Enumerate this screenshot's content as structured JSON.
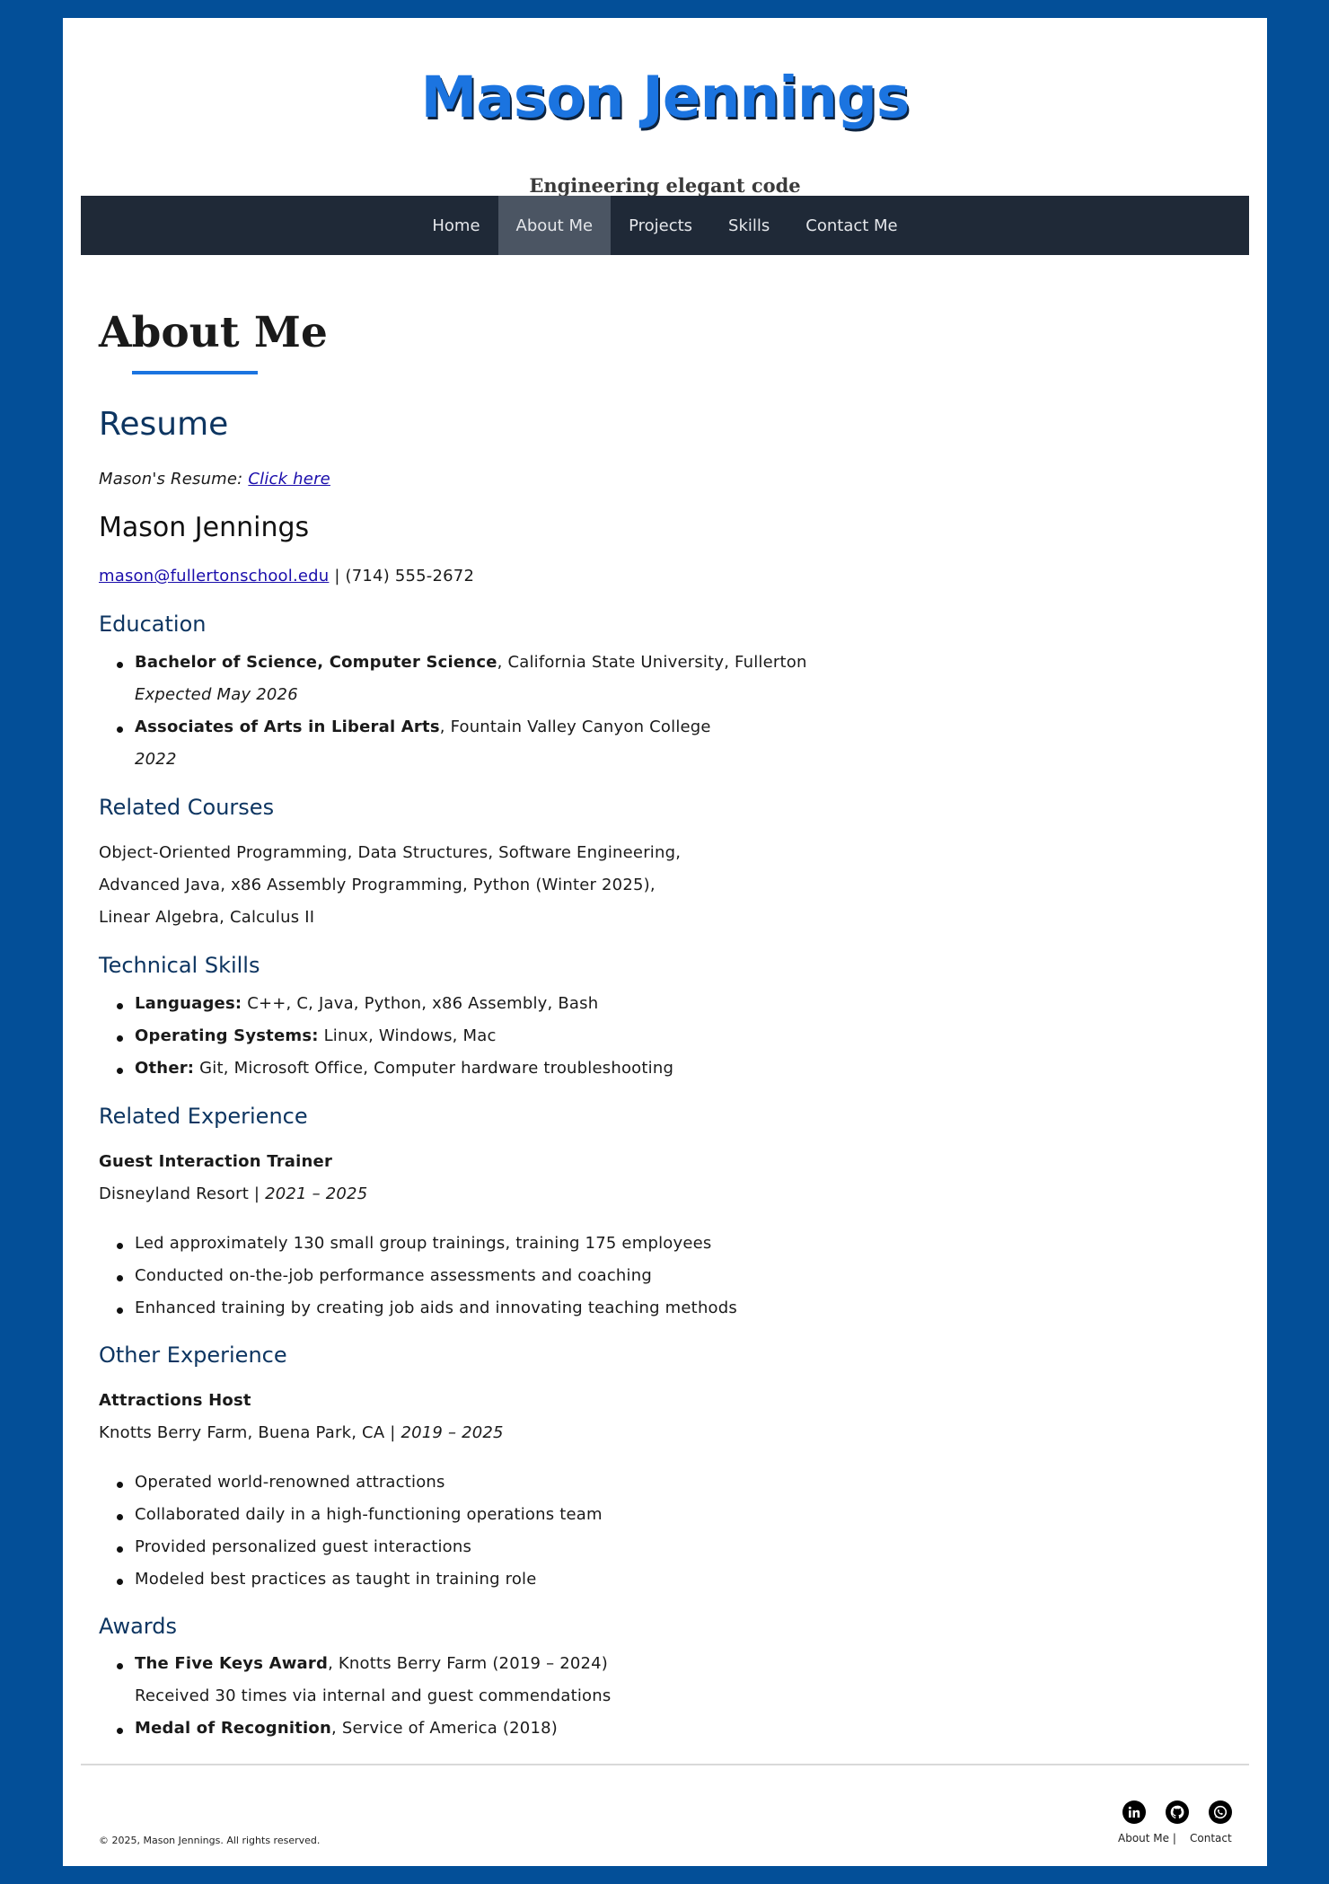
{
  "header": {
    "site_title": "Mason Jennings",
    "tagline": "Engineering elegant code"
  },
  "nav": {
    "items": [
      {
        "label": "Home"
      },
      {
        "label": "About Me",
        "active": true
      },
      {
        "label": "Projects"
      },
      {
        "label": "Skills"
      },
      {
        "label": "Contact Me"
      }
    ]
  },
  "main": {
    "page_title": "About Me",
    "resume_heading": "Resume",
    "resume_prefix": "Mason's Resume:",
    "resume_link": "Click here",
    "name": "Mason Jennings",
    "email": "mason@fullertonschool.edu",
    "phone": "| (714) 555-2672",
    "education": {
      "heading": "Education",
      "items": [
        {
          "degree": "Bachelor of Science, Computer Science",
          "school": ", California State University, Fullerton",
          "date": "Expected May 2026"
        },
        {
          "degree": "Associates of Arts in Liberal Arts",
          "school": ", Fountain Valley Canyon College",
          "date": "2022"
        }
      ]
    },
    "courses": {
      "heading": "Related Courses",
      "lines": [
        "Object-Oriented Programming, Data Structures, Software Engineering,",
        "Advanced Java, x86 Assembly Programming, Python (Winter 2025),",
        "Linear Algebra, Calculus II"
      ]
    },
    "skills": {
      "heading": "Technical Skills",
      "items": [
        {
          "label": "Languages:",
          "value": " C++, C, Java, Python, x86 Assembly, Bash"
        },
        {
          "label": "Operating Systems:",
          "value": " Linux, Windows, Mac"
        },
        {
          "label": "Other:",
          "value": " Git, Microsoft Office, Computer hardware troubleshooting"
        }
      ]
    },
    "related_experience": {
      "heading": "Related Experience",
      "title": "Guest Interaction Trainer",
      "org": "Disneyland Resort | ",
      "dates": "2021 – 2025",
      "bullets": [
        "Led approximately 130 small group trainings, training 175 employees",
        "Conducted on-the-job performance assessments and coaching",
        "Enhanced training by creating job aids and innovating teaching methods"
      ]
    },
    "other_experience": {
      "heading": "Other Experience",
      "title": "Attractions Host",
      "org": "Knotts Berry Farm, Buena Park, CA | ",
      "dates": "2019 – 2025",
      "bullets": [
        "Operated world-renowned attractions",
        "Collaborated daily in a high-functioning operations team",
        "Provided personalized guest interactions",
        "Modeled best practices as taught in training role"
      ]
    },
    "awards": {
      "heading": "Awards",
      "items": [
        {
          "name": "The Five Keys Award",
          "detail": ", Knotts Berry Farm (2019 – 2024)",
          "note": "Received 30 times via internal and guest commendations"
        },
        {
          "name": "Medal of Recognition",
          "detail": ", Service of America (2018)"
        }
      ]
    }
  },
  "footer": {
    "copyright": "© 2025, Mason Jennings. All rights reserved.",
    "links": [
      "About Me |",
      "Contact"
    ],
    "social_icons": [
      "linkedin-icon",
      "github-icon",
      "whatsapp-icon"
    ]
  }
}
